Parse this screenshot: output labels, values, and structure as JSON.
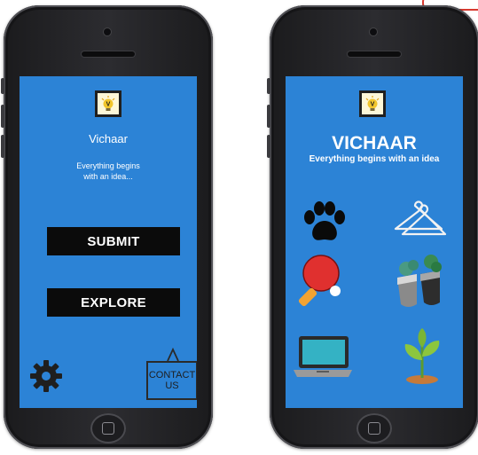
{
  "left_screen": {
    "app_name": "Vichaar",
    "tagline": "Everything begins with an idea...",
    "submit_label": "SUBMIT",
    "explore_label": "EXPLORE",
    "contact_label_line1": "CONTACT",
    "contact_label_line2": "US",
    "settings_icon": "gear-icon"
  },
  "right_screen": {
    "app_name": "VICHAAR",
    "tagline": "Everything begins with an idea",
    "categories": [
      {
        "icon": "paw-icon"
      },
      {
        "icon": "hanger-icon"
      },
      {
        "icon": "table-tennis-icon"
      },
      {
        "icon": "recycle-bins-icon"
      },
      {
        "icon": "laptop-icon"
      },
      {
        "icon": "plant-icon"
      }
    ]
  },
  "logo_letter": "V",
  "colors": {
    "screen_bg": "#2c83d6",
    "button_bg": "#0b0b0b",
    "logo_bulb": "#f1c52c"
  }
}
